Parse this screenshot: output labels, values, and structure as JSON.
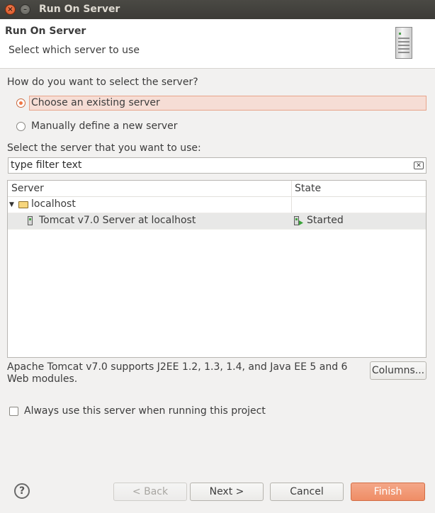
{
  "window": {
    "title": "Run On Server"
  },
  "header": {
    "title": "Run On Server",
    "subtitle": "Select which server to use",
    "icon": "server-icon"
  },
  "selection": {
    "question": "How do you want to select the server?",
    "options": [
      {
        "label": "Choose an existing server",
        "checked": true
      },
      {
        "label": "Manually define a new server",
        "checked": false
      }
    ]
  },
  "filter": {
    "label": "Select the server that you want to use:",
    "placeholder": "type filter text"
  },
  "table": {
    "columns": [
      "Server",
      "State"
    ],
    "rows": [
      {
        "name": "localhost",
        "state": "",
        "type": "folder",
        "expanded": true
      },
      {
        "name": "Tomcat v7.0 Server at localhost",
        "state": "Started",
        "type": "server",
        "selected": true
      }
    ]
  },
  "description": "Apache Tomcat v7.0 supports J2EE 1.2, 1.3, 1.4, and Java EE 5 and 6 Web modules.",
  "columns_button": "Columns...",
  "always_use": {
    "label": "Always use this server when running this project",
    "checked": false
  },
  "footer": {
    "back": "< Back",
    "next": "Next >",
    "cancel": "Cancel",
    "finish": "Finish",
    "help": "?"
  },
  "colors": {
    "accent": "#f07746",
    "primary_button": "#ef8d66"
  }
}
